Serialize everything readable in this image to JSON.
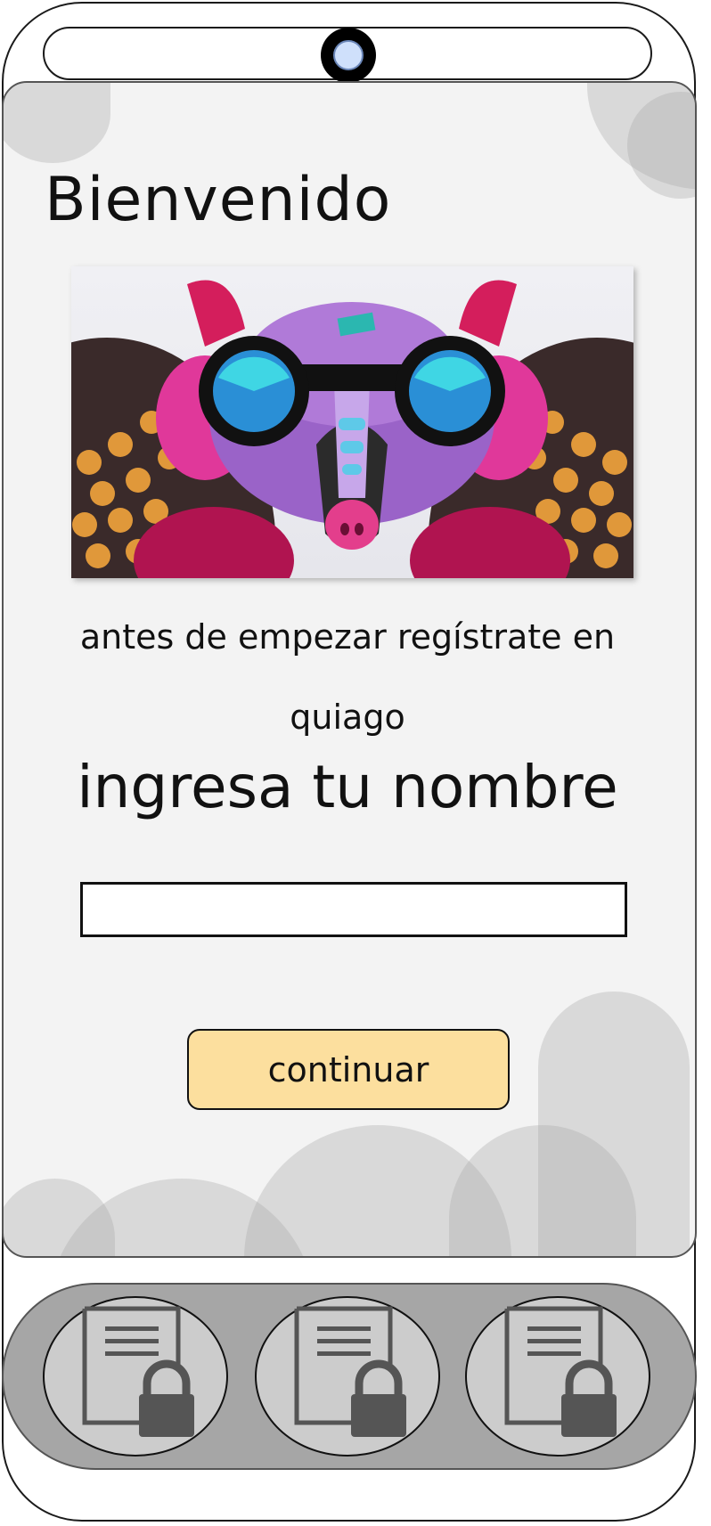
{
  "welcome": {
    "title": "Bienvenido",
    "subtitle": "antes de empezar regístrate en quiago",
    "name_label": "ingresa tu nombre",
    "name_input": {
      "value": "",
      "placeholder": ""
    },
    "continue_label": "continuar"
  },
  "bottom_nav": {
    "items": [
      {
        "icon": "locked-document-icon"
      },
      {
        "icon": "locked-document-icon"
      },
      {
        "icon": "locked-document-icon"
      }
    ]
  },
  "colors": {
    "screen_bg": "#f3f3f3",
    "button_bg": "#fcdf9e",
    "nav_bar_bg": "#a6a6a6",
    "nav_button_bg": "#cccccc"
  }
}
